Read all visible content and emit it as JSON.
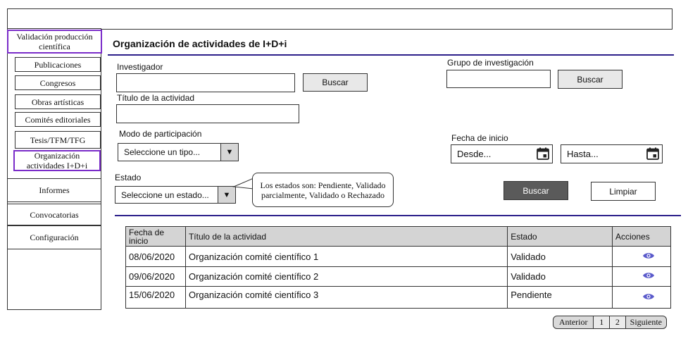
{
  "sidebar": {
    "items": [
      {
        "label": "Validación producción científica"
      },
      {
        "label": "Publicaciones"
      },
      {
        "label": "Congresos"
      },
      {
        "label": "Obras artísticas"
      },
      {
        "label": "Comités editoriales"
      },
      {
        "label": "Tesis/TFM/TFG"
      },
      {
        "label": "Organización actividades I+D+i"
      },
      {
        "label": "Informes"
      },
      {
        "label": "Convocatorias"
      },
      {
        "label": "Configuración"
      }
    ]
  },
  "main": {
    "title": "Organización de actividades de I+D+i"
  },
  "filters": {
    "investigador_label": "Investigador",
    "investigador_value": "",
    "buscar_label": "Buscar",
    "grupo_label": "Grupo de investigación",
    "grupo_value": "",
    "titulo_label": "Título de la actividad",
    "titulo_value": "",
    "modo_label": "Modo de participación",
    "modo_selected": "Seleccione un tipo...",
    "fecha_label": "Fecha de inicio",
    "desde_placeholder": "Desde...",
    "hasta_placeholder": "Hasta...",
    "estado_label": "Estado",
    "estado_selected": "Seleccione un estado...",
    "tooltip": "Los estados son: Pendiente, Validado parcialmente, Validado o Rechazado",
    "search_button": "Buscar",
    "clear_button": "Limpiar"
  },
  "table": {
    "headers": [
      "Fecha de inicio",
      "Título de la actividad",
      "Estado",
      "Acciones"
    ],
    "rows": [
      {
        "fecha": "08/06/2020",
        "titulo": "Organización comité científico 1",
        "estado": "Validado"
      },
      {
        "fecha": "09/06/2020",
        "titulo": "Organización comité científico 2",
        "estado": "Validado"
      },
      {
        "fecha": "15/06/2020",
        "titulo": "Organización comité científico 3",
        "estado": "Pendiente"
      }
    ],
    "action_icon": "eye-icon"
  },
  "pagination": {
    "prev": "Anterior",
    "pages": [
      "1",
      "2"
    ],
    "next": "Siguiente"
  },
  "colors": {
    "accent": "#7a2cc9",
    "divider": "#2c1f8a",
    "eye": "#5a5acb",
    "dark_button": "#5a5a5a"
  }
}
